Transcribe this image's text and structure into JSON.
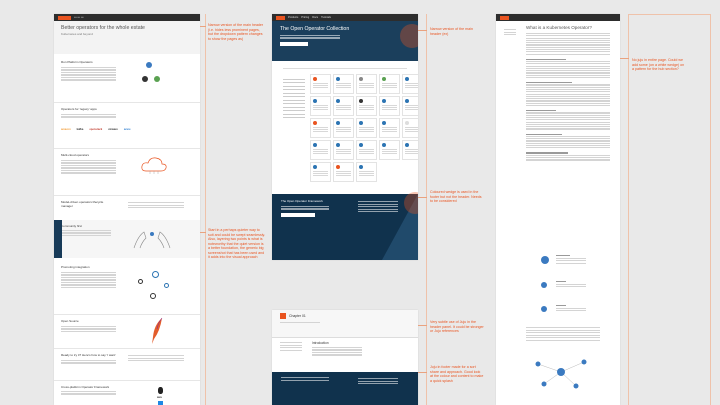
{
  "left_page": {
    "hero_title": "Better operators for the whole estate",
    "hero_subtitle": "Kubernetes and beyond",
    "sections": [
      {
        "title": "Run Platform Operators"
      },
      {
        "title": "Operators for ‘legacy’ apps"
      },
      {
        "title": "Multi-cloud operators"
      },
      {
        "title": "Model-driven operators lifecycle manager"
      },
      {
        "title": "Community first"
      },
      {
        "title": "Promoting integration"
      },
      {
        "title": "Open Source"
      },
      {
        "title": "Ready to try it? Here's how to say 'I want'"
      },
      {
        "title": "Cross-platform Operator Framework"
      }
    ],
    "partner_logos": [
      "amazon",
      "kafka",
      "openstack",
      "vmware",
      "azure"
    ]
  },
  "middle_page": {
    "title": "The Open Operator Collection",
    "nav": [
      "Products",
      "Pricing",
      "Docs",
      "Tutorials"
    ],
    "footer_title": "The Open Operator Framework"
  },
  "mini_page": {
    "title": "Chapter 01",
    "section_title": "Introduction"
  },
  "right_page": {
    "title": "What is a Kubernetes Operator?"
  },
  "notes": {
    "n1": "Narrow version of the main header (i.e. hides less prominent pages, but the dropdown pattern changes to show the pages as)",
    "n2": "Narrow version of the main header (ex)",
    "n3": "Coloured wedge is used in the footer but not the header. Needs to be considered",
    "n4": "Start in a perhaps quieter way to suit and could be swept seamlessly. Also, layering two points is what is noteworthy that the quiet version is a better foundation, the generic big screenshot that has been used and it adds into the visual approach",
    "n5": "Very subtle use of Juju in the header panel. It could be stronger or Juju references",
    "n6": "Juju in footer made for a sort share and approach. Good look at the colour and content to make a quick splash",
    "n7": "No juju in entire page. Could we add some (on a white wedge) on a pattern for the hub section?"
  }
}
